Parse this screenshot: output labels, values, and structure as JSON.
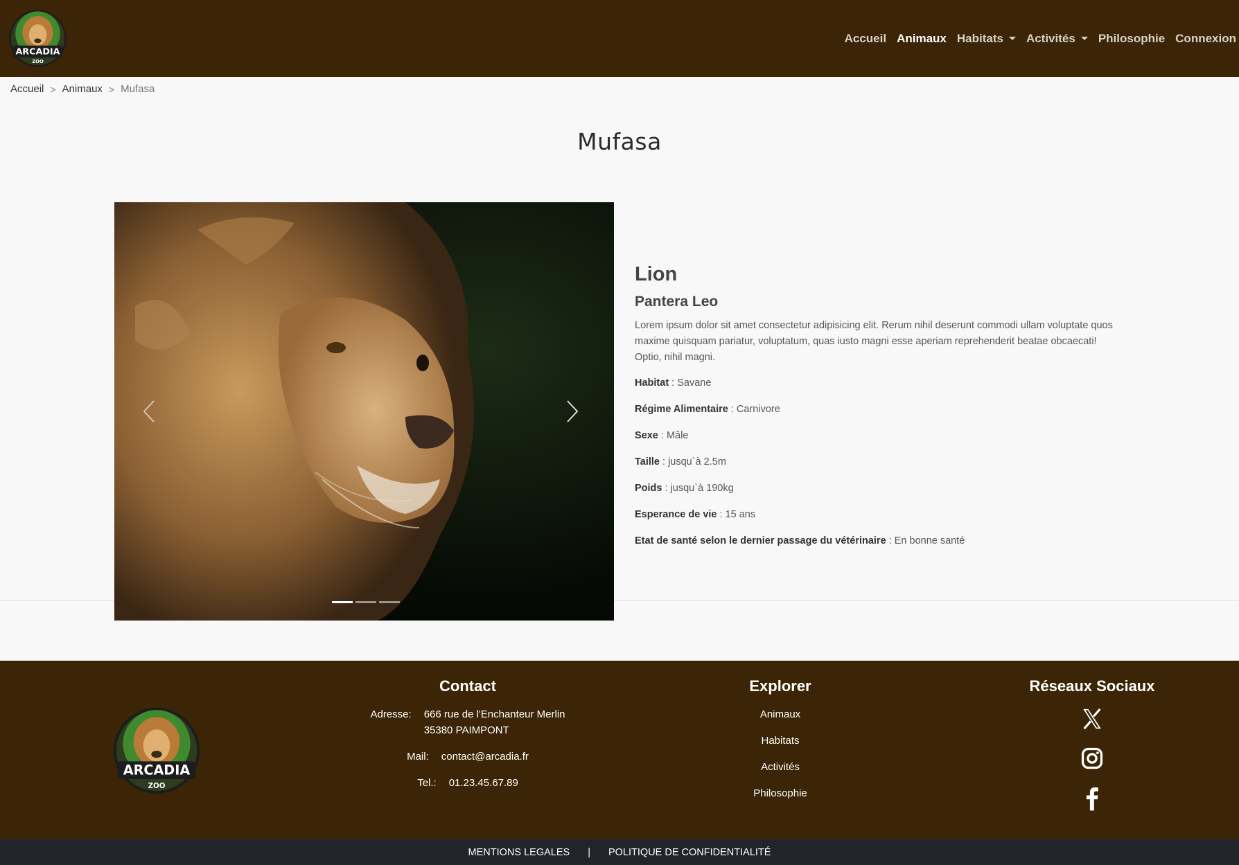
{
  "nav": {
    "logo_text": "ARCADIA",
    "logo_sub": "ZOO",
    "links": [
      {
        "label": "Accueil"
      },
      {
        "label": "Animaux"
      },
      {
        "label": "Habitats"
      },
      {
        "label": "Activités"
      },
      {
        "label": "Philosophie"
      },
      {
        "label": "Connexion"
      }
    ]
  },
  "breadcrumb": {
    "items": [
      "Accueil",
      "Animaux"
    ],
    "current": "Mufasa",
    "separator": ">"
  },
  "page_title": "Mufasa",
  "carousel": {
    "prev_icon": "chevron-left-icon",
    "next_icon": "chevron-right-icon",
    "slides_count": 3,
    "active_slide": 1
  },
  "animal": {
    "species": "Lion",
    "latin_name": "Pantera Leo",
    "description": "Lorem ipsum dolor sit amet consectetur adipisicing elit. Rerum nihil deserunt commodi ullam voluptate quos maxime quisquam pariatur, voluptatum, quas iusto magni esse aperiam reprehenderit beatae obcaecati! Optio, nihil magni.",
    "attributes": [
      {
        "label": "Habitat",
        "value": " : Savane"
      },
      {
        "label": "Régime Alimentaire",
        "value": " : Carnivore"
      },
      {
        "label": "Sexe",
        "value": " : Mâle"
      },
      {
        "label": "Taille",
        "value": " : jusqu`à 2.5m"
      },
      {
        "label": "Poids",
        "value": " : jusqu`à 190kg"
      },
      {
        "label": "Esperance de vie",
        "value": " : 15 ans"
      },
      {
        "label": "Etat de santé selon le dernier passage du vétérinaire",
        "value": " : En bonne santé"
      }
    ]
  },
  "footer": {
    "contact": {
      "title": "Contact",
      "address_label": "Adresse:",
      "address_line1": "666 rue de l'Enchanteur Merlin",
      "address_line2": "35380 PAIMPONT",
      "mail_label": "Mail:",
      "mail": "contact@arcadia.fr",
      "tel_label": "Tel.:",
      "tel": "01.23.45.67.89"
    },
    "explore": {
      "title": "Explorer",
      "links": [
        "Animaux",
        "Habitats",
        "Activités",
        "Philosophie"
      ]
    },
    "social": {
      "title": "Réseaux Sociaux",
      "icons": [
        "x-icon",
        "instagram-icon",
        "facebook-icon"
      ]
    }
  },
  "bottom": {
    "legal": "MENTIONS LEGALES",
    "separator": "|",
    "privacy": "POLITIQUE DE CONFIDENTIALITÉ"
  },
  "colors": {
    "brand_brown": "#3c2506",
    "bottom_bar": "#212529",
    "page_bg": "#f8f8f8"
  }
}
